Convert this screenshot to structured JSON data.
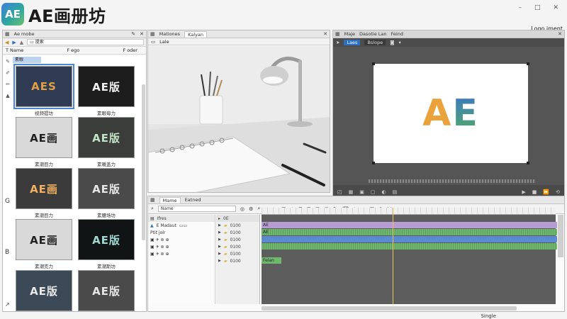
{
  "brand": {
    "logo_text": "AE",
    "title": "AE画册坊"
  },
  "window": {
    "minimize": "–",
    "maximize": "□",
    "close": "✕",
    "right_label": "Logo iment"
  },
  "colors": {
    "accent": "#4a88d6",
    "ae_orange": "#e9a33a",
    "ae_green": "#4fae63",
    "ae_blue": "#3d74c9",
    "timeline_purple": "#b79bd3",
    "timeline_green": "#6fb86e",
    "timeline_blue": "#5a8bd0"
  },
  "library": {
    "tab": "Ae mobe",
    "search": "提索",
    "columns": [
      "T  Name",
      "F  ego",
      "F  oder"
    ],
    "group_header": "素眼",
    "side_letters": [
      "G",
      "B"
    ],
    "items": [
      {
        "text": "AES",
        "label": "视频提坊",
        "style": "dark-blue",
        "selected": true
      },
      {
        "text": "AE版",
        "label": "素眼母力",
        "style": "black"
      },
      {
        "text": "AE画",
        "label": "素潮目力",
        "style": "light"
      },
      {
        "text": "AE版",
        "label": "素暖盖力",
        "style": "dark-green"
      },
      {
        "text": "AE画",
        "label": "素潮目力",
        "style": "photo"
      },
      {
        "text": "AE版",
        "label": "素腰场坊",
        "style": "dark-gray"
      },
      {
        "text": "AE画",
        "label": "素潮克力",
        "style": "light"
      },
      {
        "text": "AE版",
        "label": "素潮斯坊",
        "style": "black-teal"
      },
      {
        "text": "AE版",
        "label": "",
        "style": "slate"
      },
      {
        "text": "AE版",
        "label": "",
        "style": "dark-gray"
      }
    ]
  },
  "viewer": {
    "tabs": [
      "Mationes",
      "Kalyan"
    ],
    "subtab": "Lale"
  },
  "composition": {
    "tabs": [
      "Maje",
      "Dasotie Lan",
      "Feind"
    ],
    "tool_active": "Laes",
    "tool_second": "Bslope",
    "canvas_text_a": "A",
    "canvas_text_e": "E"
  },
  "timeline": {
    "tabs": [
      "Mame",
      "Eatned"
    ],
    "search_label": "Name",
    "layer_header": "Ifres",
    "layer_title": "E Madaut",
    "layer_sub": "Ptit  jolr",
    "col_header": "0E",
    "col_rows": [
      "0100",
      "0100",
      "0100",
      "0100",
      "0100",
      "0100"
    ],
    "clips": [
      {
        "label": "AE",
        "color": "#b79bd3",
        "row": 0
      },
      {
        "label": "AE",
        "color": "#6fb86e",
        "row": 1
      },
      {
        "label": "",
        "color": "#5a8bd0",
        "row": 2
      },
      {
        "label": "",
        "color": "#6fb86e",
        "row": 3
      },
      {
        "label": "Felan",
        "color": "#6fb86e",
        "row": 5
      }
    ],
    "status": "Single"
  }
}
